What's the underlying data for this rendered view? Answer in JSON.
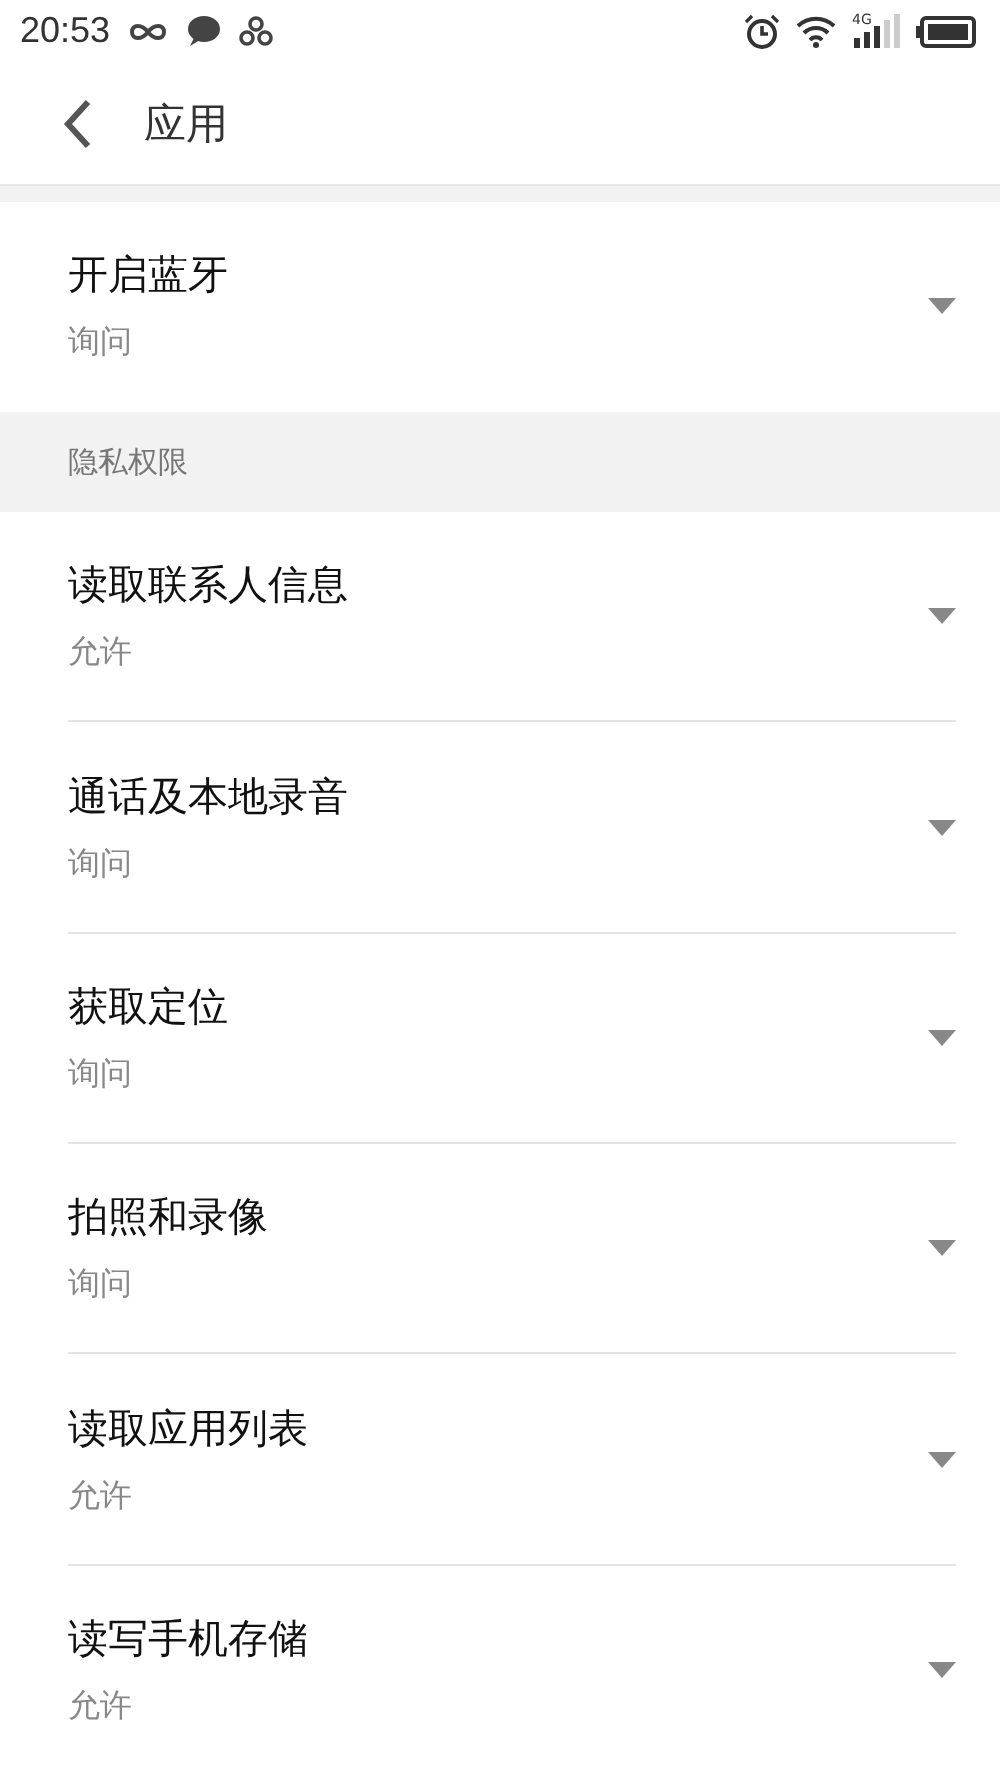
{
  "status_bar": {
    "time": "20:53",
    "network": "4G"
  },
  "header": {
    "title": "应用"
  },
  "sections": [
    {
      "items": [
        {
          "title": "开启蓝牙",
          "value": "询问"
        }
      ]
    },
    {
      "header": "隐私权限",
      "items": [
        {
          "title": "读取联系人信息",
          "value": "允许"
        },
        {
          "title": "通话及本地录音",
          "value": "询问"
        },
        {
          "title": "获取定位",
          "value": "询问"
        },
        {
          "title": "拍照和录像",
          "value": "询问"
        },
        {
          "title": "读取应用列表",
          "value": "允许"
        },
        {
          "title": "读写手机存储",
          "value": "允许"
        }
      ]
    }
  ]
}
